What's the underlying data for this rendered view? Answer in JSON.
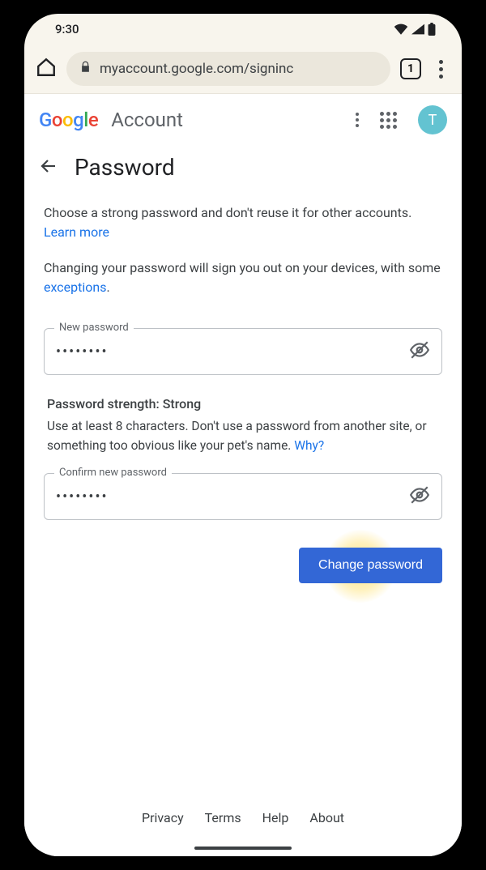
{
  "status": {
    "time": "9:30",
    "tab_count": "1"
  },
  "browser": {
    "url": "myaccount.google.com/signinc"
  },
  "header": {
    "logo_g1": "G",
    "logo_o1": "o",
    "logo_o2": "o",
    "logo_g2": "g",
    "logo_l": "l",
    "logo_e": "e",
    "account_label": "Account",
    "avatar_initial": "T"
  },
  "page": {
    "title": "Password",
    "intro_text": "Choose a strong password and don't reuse it for other accounts. ",
    "learn_more": "Learn more",
    "signout_text_a": "Changing your password will sign you out on your de­vices, with some ",
    "exceptions": "exceptions",
    "period": "."
  },
  "fields": {
    "new_password_label": "New password",
    "new_password_value": "••••••••",
    "confirm_label": "Confirm new password",
    "confirm_value": "••••••••"
  },
  "strength": {
    "title": "Password strength: Strong",
    "desc": "Use at least 8 characters. Don't use a password from another site, or something too obvious like your pet's name. ",
    "why": "Why?"
  },
  "actions": {
    "change_button": "Change password"
  },
  "footer": {
    "privacy": "Privacy",
    "terms": "Terms",
    "help": "Help",
    "about": "About"
  }
}
